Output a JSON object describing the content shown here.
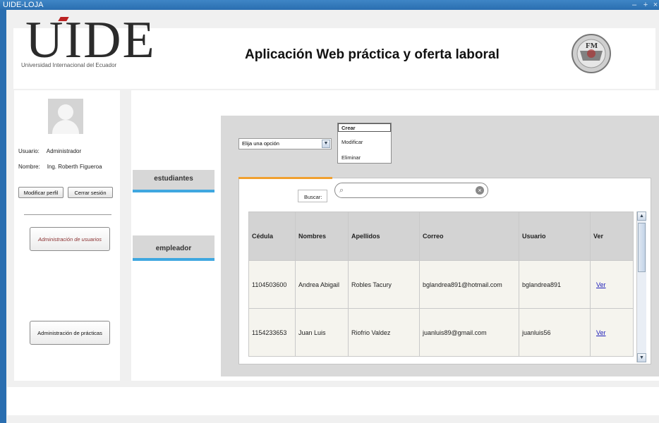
{
  "window": {
    "title": "UIDE-LOJA",
    "controls": [
      "–",
      "+",
      "×"
    ]
  },
  "header": {
    "logo_text": "UIDE",
    "logo_subtitle": "Universidad Internacional del Ecuador",
    "app_title": "Aplicación Web práctica y oferta laboral",
    "seal_text": "FM"
  },
  "sidebar": {
    "user_label": "Usuario:",
    "user_value": "Administrador",
    "name_label": "Nombre:",
    "name_value": "Ing. Roberth Figueroa",
    "edit_profile": "Modificar perfil",
    "logout": "Cerrar sesión",
    "admin_users": "Administración de usuarios",
    "admin_practices": "Administración de prácticas"
  },
  "nav": {
    "students": "estudiantes",
    "employer": "empleador"
  },
  "actions": {
    "select_placeholder": "Elija una opción",
    "menu": [
      "Crear",
      "Modificar",
      "Eliminar"
    ]
  },
  "search": {
    "label": "Buscar:",
    "value": ""
  },
  "table": {
    "headers": [
      "Cédula",
      "Nombres",
      "Apellidos",
      "Correo",
      "Usuario",
      "Ver"
    ],
    "rows": [
      [
        "1104503600",
        "Andrea Abigail",
        "Robles Tacury",
        "bglandrea891@hotmail.com",
        "bglandrea891",
        "Ver"
      ],
      [
        "1154233653",
        "Juan Luis",
        "Riofrio Valdez",
        "juanluis89@gmail.com",
        "juanluis56",
        "Ver"
      ]
    ]
  },
  "colors": {
    "titlebar": "#2a6eb0",
    "nav_accent": "#3fa7e0",
    "tab_accent": "#f0a030",
    "link": "#1a1ab8"
  }
}
